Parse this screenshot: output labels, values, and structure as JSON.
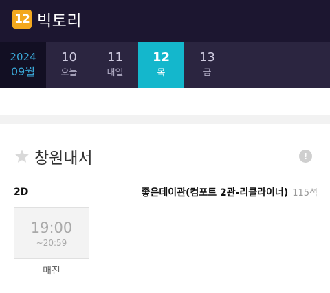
{
  "app": {
    "logo_text": "12",
    "name": "빅토리"
  },
  "date_selector": {
    "year": "2024",
    "month": "09월",
    "days": [
      {
        "num": "10",
        "label": "오늘"
      },
      {
        "num": "11",
        "label": "내일"
      },
      {
        "num": "12",
        "label": "목",
        "selected": true
      },
      {
        "num": "13",
        "label": "금"
      }
    ]
  },
  "theater": {
    "name": "창원내서",
    "info_icon": "!",
    "format": "2D",
    "screen": "좋은데이관(컴포트 2관-리클라이너)",
    "seats": "115석",
    "showtimes": [
      {
        "start": "19:00",
        "end": "~20:59",
        "status": "매진"
      }
    ]
  },
  "colors": {
    "header_bg": "#1c1630",
    "accent": "#14b7cc",
    "logo": "#f3a81e"
  }
}
